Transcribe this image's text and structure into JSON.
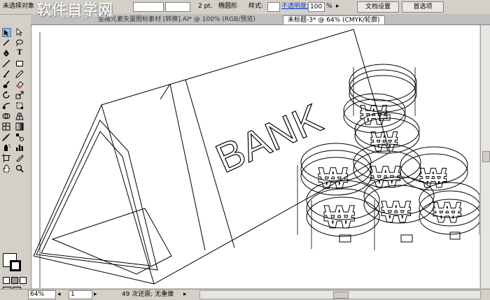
{
  "control_bar": {
    "selection_status": "未选择对象",
    "stroke_width": "2 pt.",
    "brush_shape": "椭圆形",
    "style_label": "样式:",
    "opacity_label": "不透明度:",
    "opacity_value": "100",
    "opacity_unit": "%",
    "doc_setup_button": "文档设置",
    "preferences_button": "首选项"
  },
  "watermark": {
    "text": "软件自学网",
    "url": "WWW.RJZXW.COM"
  },
  "tabs": [
    {
      "label": "金融元素矢量图标素材 [转换].AI* @ 100% (RGB/预览)"
    },
    {
      "label": "未标题-3* @ 64% (CMYK/轮廓)"
    }
  ],
  "canvas": {
    "sign_text": "BANK",
    "coin_symbol": "₩"
  },
  "status_bar": {
    "zoom": "64%",
    "page": "1",
    "undo_status": "49 次还原; 无重做"
  },
  "icons": [
    "selection-tool-icon",
    "direct-selection-tool-icon",
    "magic-wand-icon",
    "lasso-icon",
    "pen-tool-icon",
    "type-tool-icon",
    "line-tool-icon",
    "rectangle-tool-icon",
    "paintbrush-icon",
    "pencil-icon",
    "blob-brush-icon",
    "eraser-icon",
    "rotate-tool-icon",
    "scale-tool-icon",
    "warp-tool-icon",
    "free-transform-icon",
    "shape-builder-icon",
    "perspective-grid-icon",
    "mesh-tool-icon",
    "gradient-tool-icon",
    "eyedropper-icon",
    "blend-tool-icon",
    "symbol-sprayer-icon",
    "graph-tool-icon",
    "artboard-tool-icon",
    "slice-tool-icon",
    "hand-tool-icon",
    "zoom-tool-icon"
  ],
  "colors": {
    "ui_background": "#d4d0c8",
    "canvas": "#ffffff",
    "outline": "#000000"
  }
}
